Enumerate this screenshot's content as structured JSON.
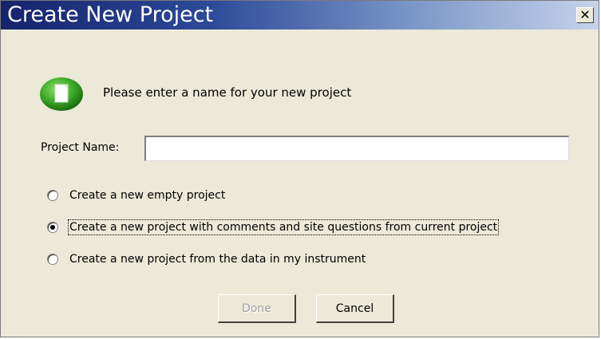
{
  "window": {
    "title": "Create New Project",
    "close_symbol": "✕"
  },
  "icons": {
    "app": "green-project-icon"
  },
  "prompt": "Please enter a name for your new project",
  "project_name": {
    "label": "Project Name:",
    "value": "",
    "placeholder": ""
  },
  "options": [
    {
      "label": "Create a new empty project",
      "checked": false
    },
    {
      "label": "Create a new project with comments and site questions from current project",
      "checked": true
    },
    {
      "label": "Create a new project from the data in my instrument",
      "checked": false
    }
  ],
  "buttons": {
    "done": {
      "label": "Done",
      "enabled": false
    },
    "cancel": {
      "label": "Cancel",
      "enabled": true
    }
  },
  "colors": {
    "dialog_bg": "#ece9d8",
    "titlebar_start": "#15236b",
    "titlebar_end": "#c6d3ea",
    "icon_green": "#3fae2a"
  }
}
